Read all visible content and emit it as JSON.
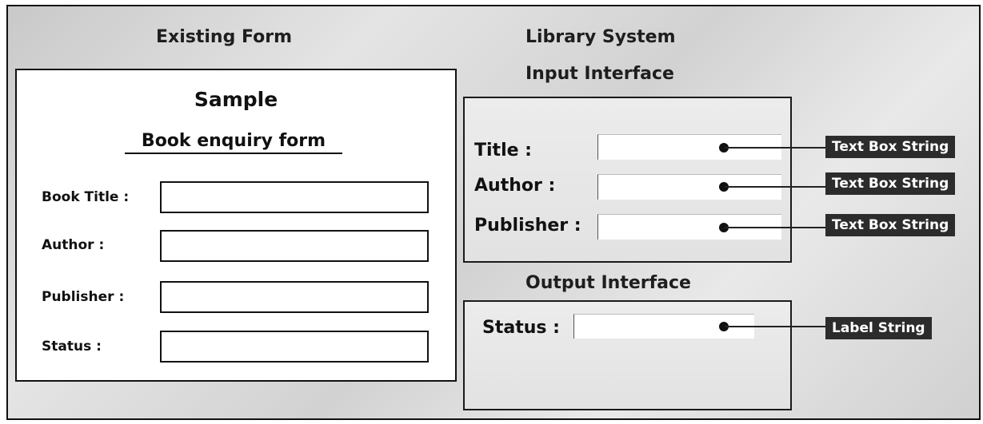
{
  "existing_form": {
    "heading": "Existing Form",
    "title": "Sample",
    "subtitle": "Book enquiry form",
    "fields": [
      {
        "label": "Book Title :"
      },
      {
        "label": "Author :"
      },
      {
        "label": "Publisher :"
      },
      {
        "label": "Status :"
      }
    ]
  },
  "library_system": {
    "heading": "Library System",
    "input_heading": "Input Interface",
    "output_heading": "Output Interface",
    "input_fields": [
      {
        "label": "Title :",
        "type_tag": "Text Box String"
      },
      {
        "label": "Author :",
        "type_tag": "Text Box String"
      },
      {
        "label": "Publisher :",
        "type_tag": "Text Box String"
      }
    ],
    "output_fields": [
      {
        "label": "Status :",
        "type_tag": "Label String"
      }
    ]
  },
  "colors": {
    "panel_border": "#111111",
    "tag_background": "#2c2c2c",
    "tag_text": "#ffffff",
    "background_gray": "#d8d8d8"
  }
}
